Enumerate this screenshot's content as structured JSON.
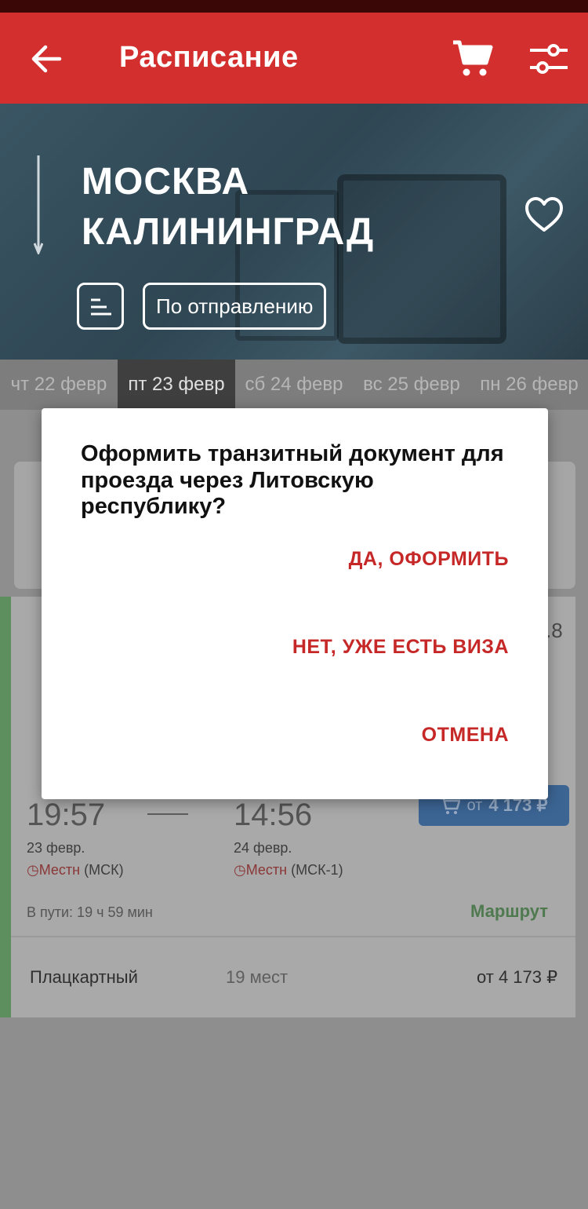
{
  "app_bar": {
    "title": "Расписание"
  },
  "hero": {
    "from": "МОСКВА",
    "to": "КАЛИНИНГРАД",
    "sort_label": "По отправлению"
  },
  "dates": [
    {
      "label": "чт 22 февр",
      "active": false
    },
    {
      "label": "пт 23 февр",
      "active": true
    },
    {
      "label": "сб 24 февр",
      "active": false
    },
    {
      "label": "вс 25 февр",
      "active": false
    },
    {
      "label": "пн 26 февр",
      "active": false
    }
  ],
  "train": {
    "dep_time": "19:57",
    "arr_time": "14:56",
    "dep_date": "23 февр.",
    "arr_date": "24 февр.",
    "dep_tz": "Местн",
    "dep_tz_note": " (МСК)",
    "arr_tz": "Местн",
    "arr_tz_note": " (МСК-1)",
    "buy_prefix": "от",
    "buy_amount": "4 173 ₽",
    "travel_time": "В пути: 19 ч 59 мин",
    "route_label": "Маршрут",
    "class_name": "Плацкартный",
    "seats": "19 мест",
    "class_price": "от 4 173 ₽",
    "partial_number": ".8"
  },
  "dialog": {
    "question": "Оформить транзитный документ для проезда через Литовскую республику?",
    "yes": "ДА, ОФОРМИТЬ",
    "no": "НЕТ, УЖЕ ЕСТЬ ВИЗА",
    "cancel": "ОТМЕНА"
  },
  "colors": {
    "accent_red": "#d32f2f",
    "dialog_action": "#c62828",
    "route_green": "#4caf50",
    "buy_blue": "#1e88e5"
  },
  "icons": [
    "back-arrow-icon",
    "cart-icon",
    "filters-icon",
    "direction-arrow-icon",
    "heart-icon",
    "sort-icon"
  ]
}
